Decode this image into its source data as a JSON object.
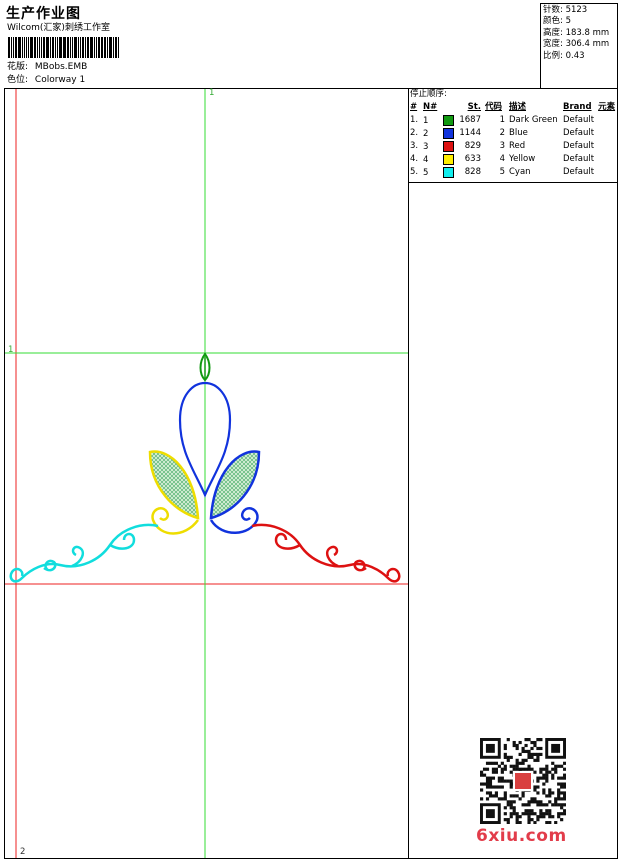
{
  "header": {
    "title": "生产作业图",
    "studio": "Wilcom(汇家)刺绣工作室",
    "design_label": "花版:",
    "design_value": "MBobs.EMB",
    "colorway_label": "色位:",
    "colorway_value": "Colorway 1"
  },
  "stats": [
    {
      "label": "针数:",
      "value": "5123"
    },
    {
      "label": "颜色:",
      "value": "5"
    },
    {
      "label": "高度:",
      "value": "183.8 mm"
    },
    {
      "label": "宽度:",
      "value": "306.4 mm"
    },
    {
      "label": "比例:",
      "value": "0.43"
    }
  ],
  "sequence": {
    "title": "停止顺序:",
    "headers": [
      "#",
      "N#",
      "St.",
      "代码",
      "描述",
      "Brand",
      "元素"
    ],
    "rows": [
      {
        "idx": "1.",
        "n": "1",
        "color": "#119911",
        "st": "1687",
        "code": "1",
        "desc": "Dark Green",
        "brand": "Default"
      },
      {
        "idx": "2.",
        "n": "2",
        "color": "#1133dd",
        "st": "1144",
        "code": "2",
        "desc": "Blue",
        "brand": "Default"
      },
      {
        "idx": "3.",
        "n": "3",
        "color": "#dd1111",
        "st": "829",
        "code": "3",
        "desc": "Red",
        "brand": "Default"
      },
      {
        "idx": "4.",
        "n": "4",
        "color": "#ffee00",
        "st": "633",
        "code": "4",
        "desc": "Yellow",
        "brand": "Default"
      },
      {
        "idx": "5.",
        "n": "5",
        "color": "#11eeee",
        "st": "828",
        "code": "5",
        "desc": "Cyan",
        "brand": "Default"
      }
    ]
  },
  "canvas": {
    "marker_top": "1",
    "marker_left": "1",
    "marker_bottom": "2",
    "guide_green": "#33dd33",
    "guide_red": "#ee2222"
  },
  "watermark": "6xiu.com"
}
